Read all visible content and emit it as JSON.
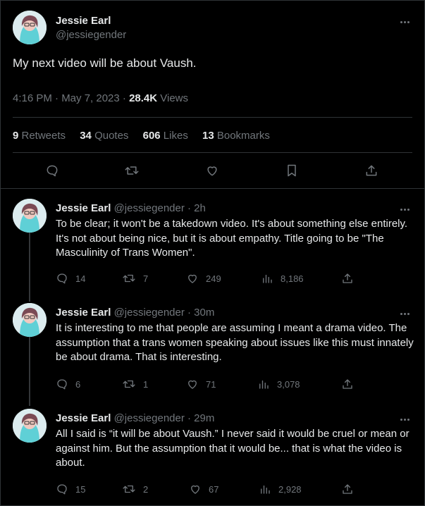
{
  "main_tweet": {
    "author_name": "Jessie Earl",
    "author_handle": "@jessiegender",
    "text": "My next video will be about Vaush.",
    "time": "4:16 PM · May 7, 2023 · ",
    "views_count": "28.4K",
    "views_label": " Views",
    "stats": {
      "retweets_count": "9",
      "retweets_label": " Retweets",
      "quotes_count": "34",
      "quotes_label": " Quotes",
      "likes_count": "606",
      "likes_label": " Likes",
      "bookmarks_count": "13",
      "bookmarks_label": " Bookmarks"
    },
    "actions": [
      "reply-icon",
      "retweet-icon",
      "like-icon",
      "bookmark-icon",
      "share-icon"
    ]
  },
  "replies": [
    {
      "name": "Jessie Earl",
      "handle_time": " @jessiegender · 2h",
      "text": "To be clear; it won't be a takedown video. It's about something else entirely. It's not about being nice, but it is about empathy. Title going to be \"The Masculinity of Trans Women\".",
      "replies": "14",
      "retweets": "7",
      "likes": "249",
      "views": "8,186"
    },
    {
      "name": "Jessie Earl",
      "handle_time": " @jessiegender · 30m",
      "text": "It is interesting to me that people are assuming I meant a drama video. The assumption that a trans women speaking about issues like this must innately be about drama. That is interesting.",
      "replies": "6",
      "retweets": "1",
      "likes": "71",
      "views": "3,078"
    },
    {
      "name": "Jessie Earl",
      "handle_time": " @jessiegender · 29m",
      "text": "All I said is “it will be about Vaush.” I never said it would be cruel or mean or against him. But the assumption that it would be... that is what the video is about.",
      "replies": "15",
      "retweets": "2",
      "likes": "67",
      "views": "2,928"
    }
  ],
  "colors": {
    "background": "#000000",
    "text": "#e7e9ea",
    "secondary": "#71767b",
    "border": "#2f3336"
  }
}
